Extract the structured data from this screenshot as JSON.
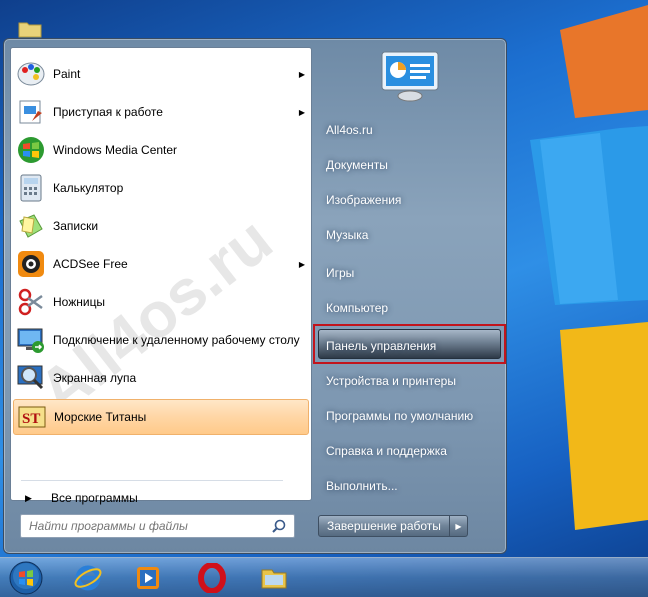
{
  "programs": [
    {
      "label": "Paint",
      "icon": "paint-icon",
      "arrow": true
    },
    {
      "label": "Приступая к работе",
      "icon": "getting-started-icon",
      "arrow": true
    },
    {
      "label": "Windows Media Center",
      "icon": "media-center-icon",
      "arrow": false
    },
    {
      "label": "Калькулятор",
      "icon": "calculator-icon",
      "arrow": false
    },
    {
      "label": "Записки",
      "icon": "sticky-notes-icon",
      "arrow": false
    },
    {
      "label": "ACDSee Free",
      "icon": "acdsee-icon",
      "arrow": true
    },
    {
      "label": "Ножницы",
      "icon": "scissors-icon",
      "arrow": false
    },
    {
      "label": "Подключение к удаленному рабочему столу",
      "icon": "remote-desktop-icon",
      "arrow": false
    },
    {
      "label": "Экранная лупа",
      "icon": "magnifier-icon",
      "arrow": false
    },
    {
      "label": "Морские Титаны",
      "icon": "sea-titans-icon",
      "arrow": false
    }
  ],
  "all_programs": "Все программы",
  "search": {
    "placeholder": "Найти программы и файлы"
  },
  "right": [
    {
      "label": "All4os.ru"
    },
    {
      "label": "Документы"
    },
    {
      "label": "Изображения"
    },
    {
      "label": "Музыка"
    },
    {
      "label": "Игры"
    },
    {
      "label": "Компьютер"
    },
    {
      "label": "Панель управления",
      "selected": true
    },
    {
      "label": "Устройства и принтеры"
    },
    {
      "label": "Программы по умолчанию"
    },
    {
      "label": "Справка и поддержка"
    },
    {
      "label": "Выполнить..."
    }
  ],
  "shutdown": {
    "label": "Завершение работы"
  },
  "watermark": "All4os.ru",
  "taskbar": [
    "start-orb-icon",
    "internet-explorer-icon",
    "media-player-icon",
    "opera-icon",
    "explorer-folder-icon"
  ],
  "colors": {
    "highlight": "#ffd6a5",
    "selection_border": "#c2141c"
  }
}
